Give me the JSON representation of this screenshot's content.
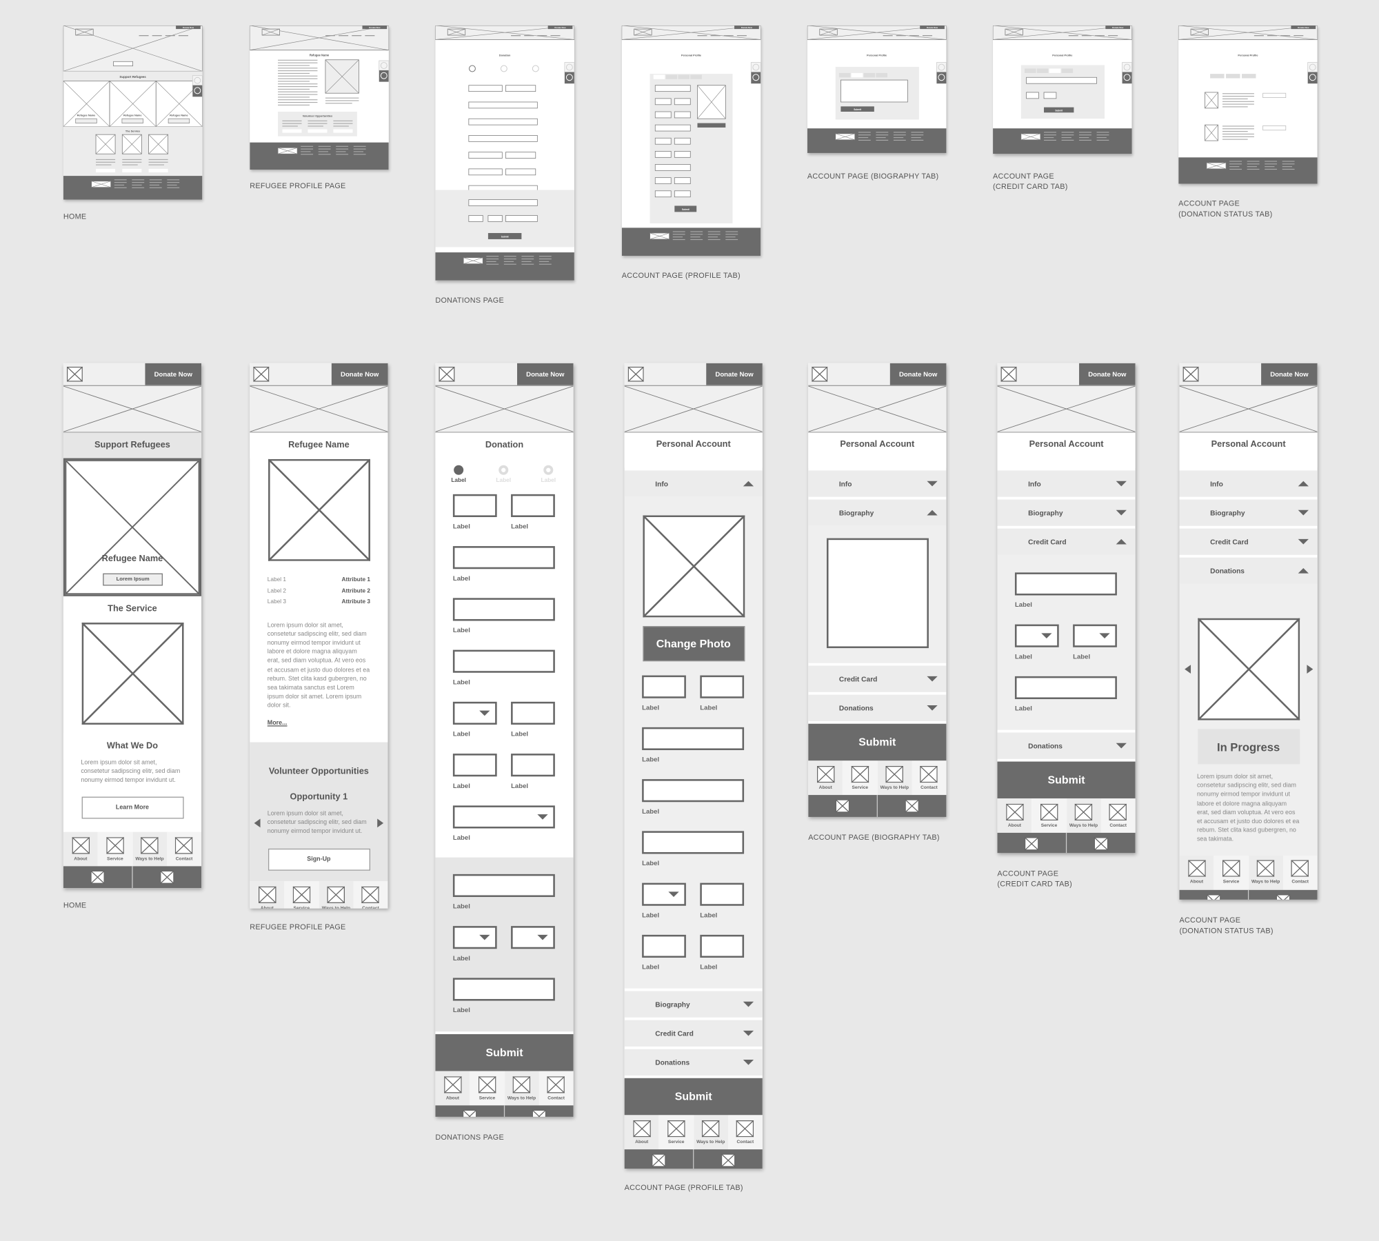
{
  "board": {
    "colors": {
      "background": "#e8e8e8",
      "frame_light": "#f0f0f0",
      "dark": "#6b6b6b",
      "stroke": "#666666",
      "text": "#555555"
    }
  },
  "desktop_wireframes": [
    {
      "caption": [
        "HOME"
      ],
      "title": "Support Refugees",
      "cards": [
        "Refugee Name",
        "Refugee Name",
        "Refugee Name"
      ],
      "section": "The Service",
      "donate": "Donate Now"
    },
    {
      "caption": [
        "REFUGEE PROFILE PAGE"
      ],
      "title": "Refugee Name",
      "section": "Volunteer Opportunities",
      "donate": "Donate Now"
    },
    {
      "caption": [
        "DONATIONS PAGE"
      ],
      "title": "Donation",
      "button": "Submit",
      "donate": "Donate Now"
    },
    {
      "caption": [
        "ACCOUNT PAGE (PROFILE TAB)"
      ],
      "title": "Personal Profile",
      "button": "Submit",
      "donate": "Donate Now"
    },
    {
      "caption": [
        "ACCOUNT PAGE (BIOGRAPHY TAB)"
      ],
      "title": "Personal Profile",
      "button": "Submit",
      "donate": "Donate Now"
    },
    {
      "caption": [
        "ACCOUNT PAGE",
        "(CREDIT CARD TAB)"
      ],
      "title": "Personal Profile",
      "button": "Submit",
      "donate": "Donate Now"
    },
    {
      "caption": [
        "ACCOUNT PAGE",
        "(DONATION STATUS TAB)"
      ],
      "title": "Personal Profile",
      "donate": "Donate Now"
    }
  ],
  "mobile_wireframes": [
    {
      "caption": [
        "HOME"
      ],
      "sections": [
        {
          "type": "header",
          "donate": "Donate Now"
        },
        {
          "type": "title",
          "text": "Support Refugees",
          "shade": "gray"
        },
        {
          "type": "hero-card",
          "title": "Refugee Name",
          "button": "Lorem Ipsum"
        },
        {
          "type": "title",
          "text": "The Service",
          "shade": "white"
        },
        {
          "type": "image",
          "size": "large"
        },
        {
          "type": "title",
          "text": "What We Do",
          "shade": "white"
        },
        {
          "type": "para",
          "text": "Lorem ipsum dolor sit amet, consetetur sadipscing elitr, sed diam nonumy eirmod tempor invidunt ut."
        },
        {
          "type": "outline-button",
          "text": "Learn More"
        },
        {
          "type": "spacer"
        },
        {
          "type": "nav",
          "items": [
            "About",
            "Service",
            "Ways to Help",
            "Contact"
          ]
        }
      ]
    },
    {
      "caption": [
        "REFUGEE PROFILE PAGE"
      ],
      "sections": [
        {
          "type": "header",
          "donate": "Donate Now"
        },
        {
          "type": "title",
          "text": "Refugee Name",
          "shade": "white"
        },
        {
          "type": "image",
          "size": "large"
        },
        {
          "type": "kv",
          "rows": [
            {
              "label": "Label 1",
              "value": "Attribute 1"
            },
            {
              "label": "Label 2",
              "value": "Attribute 2"
            },
            {
              "label": "Label 3",
              "value": "Attribute 3"
            }
          ]
        },
        {
          "type": "para",
          "text": "Lorem ipsum dolor sit amet, consetetur sadipscing elitr, sed diam nonumy eirmod tempor invidunt ut labore et dolore magna aliquyam erat, sed diam voluptua. At vero eos et accusam et justo duo dolores et ea rebum. Stet clita kasd gubergren, no sea takimata sanctus est Lorem ipsum dolor sit amet. Lorem ipsum dolor sit."
        },
        {
          "type": "link",
          "text": "More..."
        },
        {
          "type": "group",
          "shade": "gray",
          "sections": [
            {
              "type": "title",
              "text": "Volunteer Opportunities",
              "shade": "none"
            },
            {
              "type": "title",
              "text": "Opportunity 1",
              "shade": "none"
            },
            {
              "type": "carousel",
              "text": "Lorem ipsum dolor sit amet, consetetur sadipscing elitr, sed diam nonumy eirmod tempor invidunt ut."
            },
            {
              "type": "outline-button",
              "text": "Sign-Up"
            }
          ]
        },
        {
          "type": "spacer"
        },
        {
          "type": "nav",
          "items": [
            "About",
            "Service",
            "Ways to Help",
            "Contact"
          ]
        }
      ]
    },
    {
      "caption": [
        "DONATIONS PAGE"
      ],
      "sections": [
        {
          "type": "header",
          "donate": "Donate Now"
        },
        {
          "type": "title",
          "text": "Donation",
          "shade": "white"
        },
        {
          "type": "steps",
          "items": [
            {
              "label": "Label",
              "active": true
            },
            {
              "label": "Label",
              "active": false
            },
            {
              "label": "Label",
              "active": false
            }
          ]
        },
        {
          "type": "fields",
          "rows": [
            [
              {
                "kind": "text",
                "width": "half",
                "label": "Label"
              },
              {
                "kind": "text",
                "width": "half",
                "label": "Label"
              }
            ],
            [
              {
                "kind": "text",
                "width": "full",
                "label": "Label"
              }
            ],
            [
              {
                "kind": "text",
                "width": "full",
                "label": "Label"
              }
            ],
            [
              {
                "kind": "text",
                "width": "full",
                "label": "Label"
              }
            ],
            [
              {
                "kind": "select",
                "width": "half",
                "label": "Label"
              },
              {
                "kind": "text",
                "width": "half",
                "label": "Label"
              }
            ],
            [
              {
                "kind": "text",
                "width": "half",
                "label": "Label"
              },
              {
                "kind": "text",
                "width": "half",
                "label": "Label"
              }
            ],
            [
              {
                "kind": "select",
                "width": "full",
                "label": "Label"
              }
            ]
          ]
        },
        {
          "type": "group",
          "shade": "gray",
          "sections": [
            {
              "type": "fields",
              "rows": [
                [
                  {
                    "kind": "text",
                    "width": "full",
                    "label": "Label"
                  }
                ],
                [
                  {
                    "kind": "select",
                    "width": "half",
                    "label": "Label"
                  },
                  {
                    "kind": "select",
                    "width": "half",
                    "label": ""
                  }
                ],
                [
                  {
                    "kind": "text",
                    "width": "full",
                    "label": "Label"
                  }
                ]
              ]
            }
          ]
        },
        {
          "type": "submit",
          "text": "Submit"
        },
        {
          "type": "nav",
          "items": [
            "About",
            "Service",
            "Ways to Help",
            "Contact"
          ]
        }
      ]
    },
    {
      "caption": [
        "ACCOUNT PAGE (PROFILE TAB)"
      ],
      "sections": [
        {
          "type": "header",
          "donate": "Donate Now"
        },
        {
          "type": "account-title",
          "text": "Personal Account"
        },
        {
          "type": "accordion",
          "label": "Info",
          "open": true
        },
        {
          "type": "group",
          "shade": "light",
          "sections": [
            {
              "type": "image",
              "size": "large"
            },
            {
              "type": "dark-button",
              "text": "Change Photo"
            },
            {
              "type": "fields",
              "rows": [
                [
                  {
                    "kind": "text",
                    "width": "half",
                    "label": "Label"
                  },
                  {
                    "kind": "text",
                    "width": "half",
                    "label": "Label"
                  }
                ],
                [
                  {
                    "kind": "text",
                    "width": "full",
                    "label": "Label"
                  }
                ],
                [
                  {
                    "kind": "text",
                    "width": "full",
                    "label": "Label"
                  }
                ],
                [
                  {
                    "kind": "text",
                    "width": "full",
                    "label": "Label"
                  }
                ],
                [
                  {
                    "kind": "select",
                    "width": "half",
                    "label": "Label"
                  },
                  {
                    "kind": "text",
                    "width": "half",
                    "label": "Label"
                  }
                ],
                [
                  {
                    "kind": "text",
                    "width": "half",
                    "label": "Label"
                  },
                  {
                    "kind": "text",
                    "width": "half",
                    "label": "Label"
                  }
                ]
              ]
            }
          ]
        },
        {
          "type": "accordion",
          "label": "Biography",
          "open": false
        },
        {
          "type": "accordion",
          "label": "Credit Card",
          "open": false
        },
        {
          "type": "accordion",
          "label": "Donations",
          "open": false
        },
        {
          "type": "submit",
          "text": "Submit"
        },
        {
          "type": "nav",
          "items": [
            "About",
            "Service",
            "Ways to Help",
            "Contact"
          ]
        }
      ]
    },
    {
      "caption": [
        "ACCOUNT PAGE (BIOGRAPHY TAB)"
      ],
      "sections": [
        {
          "type": "header",
          "donate": "Donate Now"
        },
        {
          "type": "account-title",
          "text": "Personal Account"
        },
        {
          "type": "accordion",
          "label": "Info",
          "open": false
        },
        {
          "type": "accordion",
          "label": "Biography",
          "open": true
        },
        {
          "type": "group",
          "shade": "light",
          "sections": [
            {
              "type": "textarea"
            }
          ]
        },
        {
          "type": "accordion",
          "label": "Credit Card",
          "open": false
        },
        {
          "type": "accordion",
          "label": "Donations",
          "open": false
        },
        {
          "type": "submit",
          "text": "Submit"
        },
        {
          "type": "nav",
          "items": [
            "About",
            "Service",
            "Ways to Help",
            "Contact"
          ]
        }
      ]
    },
    {
      "caption": [
        "ACCOUNT PAGE",
        "(CREDIT CARD TAB)"
      ],
      "sections": [
        {
          "type": "header",
          "donate": "Donate Now"
        },
        {
          "type": "account-title",
          "text": "Personal Account"
        },
        {
          "type": "accordion",
          "label": "Info",
          "open": false
        },
        {
          "type": "accordion",
          "label": "Biography",
          "open": false
        },
        {
          "type": "accordion",
          "label": "Credit Card",
          "open": true
        },
        {
          "type": "group",
          "shade": "light",
          "sections": [
            {
              "type": "fields",
              "rows": [
                [
                  {
                    "kind": "text",
                    "width": "full",
                    "label": "Label"
                  }
                ],
                [
                  {
                    "kind": "select",
                    "width": "half",
                    "label": "Label"
                  },
                  {
                    "kind": "select",
                    "width": "half",
                    "label": "Label"
                  }
                ],
                [
                  {
                    "kind": "text",
                    "width": "full",
                    "label": "Label"
                  }
                ]
              ]
            }
          ]
        },
        {
          "type": "accordion",
          "label": "Donations",
          "open": false
        },
        {
          "type": "submit",
          "text": "Submit"
        },
        {
          "type": "nav",
          "items": [
            "About",
            "Service",
            "Ways to Help",
            "Contact"
          ]
        }
      ]
    },
    {
      "caption": [
        "ACCOUNT PAGE",
        "(DONATION STATUS TAB)"
      ],
      "sections": [
        {
          "type": "header",
          "donate": "Donate Now"
        },
        {
          "type": "account-title",
          "text": "Personal Account"
        },
        {
          "type": "accordion",
          "label": "Info",
          "open": true
        },
        {
          "type": "accordion",
          "label": "Biography",
          "open": false
        },
        {
          "type": "accordion",
          "label": "Credit Card",
          "open": false
        },
        {
          "type": "accordion",
          "label": "Donations",
          "open": true
        },
        {
          "type": "group",
          "shade": "light",
          "sections": [
            {
              "type": "image-carousel"
            },
            {
              "type": "progress",
              "text": "In Progress"
            },
            {
              "type": "para",
              "text": "Lorem ipsum dolor sit amet, consetetur sadipscing elitr, sed diam nonumy eirmod tempor invidunt ut labore et dolore magna aliquyam erat, sed diam voluptua. At vero eos et accusam et justo duo dolores et ea rebum. Stet clita kasd gubergren, no sea takimata."
            }
          ]
        },
        {
          "type": "spacer"
        },
        {
          "type": "nav",
          "items": [
            "About",
            "Service",
            "Ways to Help",
            "Contact"
          ]
        }
      ]
    }
  ]
}
